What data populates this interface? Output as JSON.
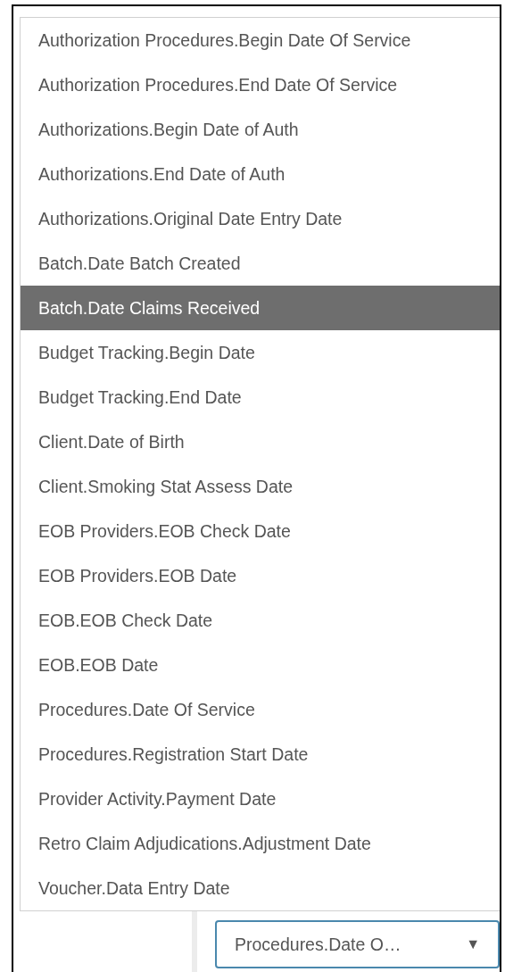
{
  "options": [
    {
      "label": "Authorization Procedures.Begin Date Of Service",
      "selected": false
    },
    {
      "label": "Authorization Procedures.End Date Of Service",
      "selected": false
    },
    {
      "label": "Authorizations.Begin Date of Auth",
      "selected": false
    },
    {
      "label": "Authorizations.End Date of Auth",
      "selected": false
    },
    {
      "label": "Authorizations.Original Date Entry Date",
      "selected": false
    },
    {
      "label": "Batch.Date Batch Created",
      "selected": false
    },
    {
      "label": "Batch.Date Claims Received",
      "selected": true
    },
    {
      "label": "Budget Tracking.Begin Date",
      "selected": false
    },
    {
      "label": "Budget Tracking.End Date",
      "selected": false
    },
    {
      "label": "Client.Date of Birth",
      "selected": false
    },
    {
      "label": "Client.Smoking Stat Assess Date",
      "selected": false
    },
    {
      "label": "EOB Providers.EOB Check Date",
      "selected": false
    },
    {
      "label": "EOB Providers.EOB Date",
      "selected": false
    },
    {
      "label": "EOB.EOB Check Date",
      "selected": false
    },
    {
      "label": "EOB.EOB Date",
      "selected": false
    },
    {
      "label": "Procedures.Date Of Service",
      "selected": false
    },
    {
      "label": "Procedures.Registration Start Date",
      "selected": false
    },
    {
      "label": "Provider Activity.Payment Date",
      "selected": false
    },
    {
      "label": "Retro Claim Adjudications.Adjustment Date",
      "selected": false
    },
    {
      "label": "Voucher.Data Entry Date",
      "selected": false
    }
  ],
  "select": {
    "value": "Procedures.Date O…",
    "caret": "▼"
  }
}
